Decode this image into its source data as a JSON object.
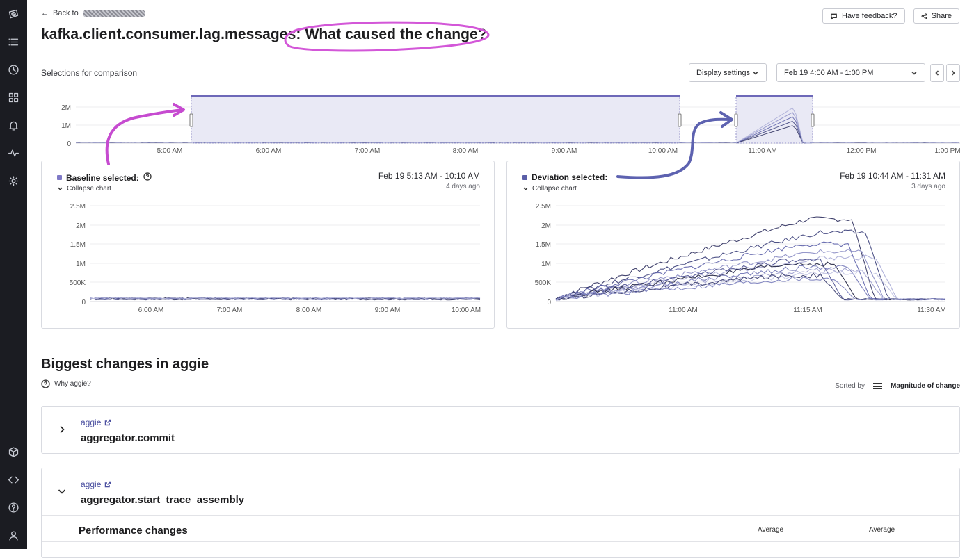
{
  "header": {
    "back_label": "Back to",
    "title_metric": "kafka.client.consumer.lag.messages",
    "title_question": ": What caused the change?",
    "feedback_label": "Have feedback?",
    "share_label": "Share"
  },
  "toolbar": {
    "selections_label": "Selections for comparison",
    "display_settings_label": "Display settings",
    "time_range_label": "Feb 19 4:00 AM - 1:00 PM"
  },
  "overview": {
    "y_ticks": [
      "2M",
      "1M",
      "0"
    ],
    "x_ticks": [
      "5:00 AM",
      "6:00 AM",
      "7:00 AM",
      "8:00 AM",
      "9:00 AM",
      "10:00 AM",
      "11:00 AM",
      "12:00 PM",
      "1:00 PM"
    ]
  },
  "baseline": {
    "heading": "Baseline selected:",
    "collapse_label": "Collapse chart",
    "range": "Feb 19 5:13 AM - 10:10 AM",
    "ago": "4 days ago",
    "color": "#7f79c6"
  },
  "deviation": {
    "heading": "Deviation selected:",
    "collapse_label": "Collapse chart",
    "range": "Feb 19 10:44 AM - 11:31 AM",
    "ago": "3 days ago",
    "color": "#5b5fa8"
  },
  "chart_data": [
    {
      "type": "line",
      "title": "Baseline selected",
      "y_ticks": [
        "2.5M",
        "2M",
        "1.5M",
        "1M",
        "500K",
        "0"
      ],
      "x_ticks": [
        "6:00 AM",
        "7:00 AM",
        "8:00 AM",
        "9:00 AM",
        "10:00 AM"
      ],
      "ylim": [
        0,
        2500000
      ],
      "xlim": [
        "5:13 AM",
        "10:10 AM"
      ],
      "series_summary": "many series near 0, approx 50000-100000 throughout"
    },
    {
      "type": "line",
      "title": "Deviation selected",
      "y_ticks": [
        "2.5M",
        "2M",
        "1.5M",
        "1M",
        "500K",
        "0"
      ],
      "x_ticks": [
        "11:00 AM",
        "11:15 AM",
        "11:30 AM"
      ],
      "ylim": [
        0,
        2500000
      ],
      "xlim": [
        "10:44 AM",
        "11:31 AM"
      ],
      "series_peaks": [
        2150000,
        1800000,
        1500000,
        1300000,
        1150000,
        1050000,
        980000,
        900000,
        820000,
        750000,
        680000,
        600000
      ]
    }
  ],
  "changes": {
    "heading": "Biggest changes in aggie",
    "why_label": "Why aggie?",
    "sorted_by_label": "Sorted by",
    "sorted_by_value": "Magnitude of change",
    "rows": [
      {
        "service": "aggie",
        "operation": "aggregator.commit"
      },
      {
        "service": "aggie",
        "operation": "aggregator.start_trace_assembly"
      }
    ],
    "perf_heading": "Performance changes",
    "col_avg_1": "Average",
    "col_avg_2": "Average"
  }
}
